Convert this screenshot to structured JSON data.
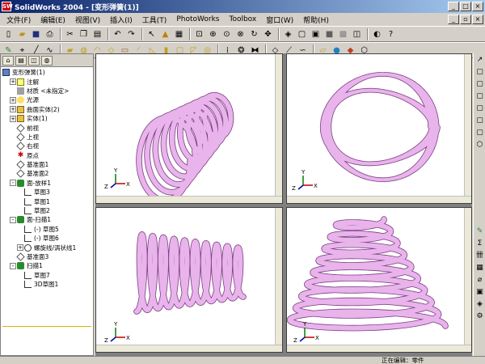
{
  "window": {
    "title": "SolidWorks 2004 - [变形弹簧(1)]",
    "app_icon": "SW"
  },
  "menu": [
    "文件(F)",
    "编辑(E)",
    "视图(V)",
    "插入(I)",
    "工具(T)",
    "PhotoWorks",
    "Toolbox",
    "窗口(W)",
    "帮助(H)"
  ],
  "tabs": [
    "feature-tab",
    "property-tab",
    "config-tab",
    "appearance-tab"
  ],
  "tree": [
    {
      "label": "变形弹簧(1)",
      "icon": "part-icon",
      "exp": "",
      "indent": 0
    },
    {
      "label": "注解",
      "icon": "note-icon",
      "exp": "+",
      "indent": 1
    },
    {
      "label": "材质 <未指定>",
      "icon": "material-icon",
      "exp": "",
      "indent": 1
    },
    {
      "label": "光源",
      "icon": "light-icon",
      "exp": "+",
      "indent": 1
    },
    {
      "label": "曲面实体(2)",
      "icon": "folder-icon",
      "exp": "+",
      "indent": 1
    },
    {
      "label": "实体(1)",
      "icon": "folder-icon",
      "exp": "+",
      "indent": 1
    },
    {
      "label": "前视",
      "icon": "plane-icon",
      "exp": "",
      "indent": 1
    },
    {
      "label": "上视",
      "icon": "plane-icon",
      "exp": "",
      "indent": 1
    },
    {
      "label": "右视",
      "icon": "plane-icon",
      "exp": "",
      "indent": 1
    },
    {
      "label": "原点",
      "icon": "origin-icon",
      "exp": "",
      "indent": 1
    },
    {
      "label": "基准面1",
      "icon": "plane-icon",
      "exp": "",
      "indent": 1
    },
    {
      "label": "基准面2",
      "icon": "plane-icon",
      "exp": "",
      "indent": 1
    },
    {
      "label": "面-放样1",
      "icon": "feature-icon",
      "exp": "-",
      "indent": 1
    },
    {
      "label": "草图3",
      "icon": "sketch-icon",
      "exp": "",
      "indent": 2
    },
    {
      "label": "草图1",
      "icon": "sketch-icon",
      "exp": "",
      "indent": 2
    },
    {
      "label": "草图2",
      "icon": "sketch-icon",
      "exp": "",
      "indent": 2
    },
    {
      "label": "面-扫描1",
      "icon": "feature-icon",
      "exp": "-",
      "indent": 1
    },
    {
      "label": "(-) 草图5",
      "icon": "sketch-icon",
      "exp": "",
      "indent": 2
    },
    {
      "label": "(-) 草图6",
      "icon": "sketch-icon",
      "exp": "",
      "indent": 2
    },
    {
      "label": "螺旋线/涡状线1",
      "icon": "helix-icon",
      "exp": "+",
      "indent": 2
    },
    {
      "label": "基准面3",
      "icon": "plane-icon",
      "exp": "",
      "indent": 1
    },
    {
      "label": "扫描1",
      "icon": "feature-icon",
      "exp": "-",
      "indent": 1
    },
    {
      "label": "草图7",
      "icon": "sketch-icon",
      "exp": "",
      "indent": 2
    },
    {
      "label": "3D草图1",
      "icon": "sketch-icon",
      "exp": "",
      "indent": 2
    }
  ],
  "views": [
    "isometric",
    "top",
    "front",
    "trimetric"
  ],
  "axes": {
    "x": "X",
    "y": "Y",
    "z": "Z"
  },
  "status": {
    "text": "正在编辑：零件"
  },
  "colors": {
    "spring": "#e9b3ec",
    "spring_edge": "#7a3f80",
    "title_from": "#0a246a",
    "title_to": "#a6caf0"
  }
}
